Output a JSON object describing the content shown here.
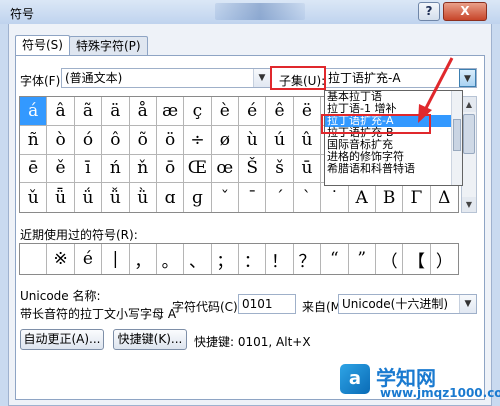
{
  "window": {
    "title": "符号",
    "help_glyph": "?",
    "close_glyph": "X"
  },
  "tabs": [
    {
      "label": "符号(S)",
      "active": true
    },
    {
      "label": "特殊字符(P)",
      "active": false
    }
  ],
  "font": {
    "label": "字体(F):",
    "value": "(普通文本)"
  },
  "subset": {
    "label": "子集(U):",
    "value": "拉丁语扩充-A"
  },
  "dropdown": {
    "items": [
      {
        "label": "基本拉丁语",
        "selected": false
      },
      {
        "label": "拉丁语-1 增补",
        "selected": false
      },
      {
        "label": "拉丁语扩充-A",
        "selected": true
      },
      {
        "label": "拉丁语扩充-B",
        "selected": false
      },
      {
        "label": "国际音标扩充",
        "selected": false
      },
      {
        "label": "进格的修饰字符",
        "selected": false
      },
      {
        "label": "希腊语和科普特语",
        "selected": false
      }
    ]
  },
  "symbols": [
    "á",
    "â",
    "ã",
    "ä",
    "å",
    "æ",
    "ç",
    "è",
    "é",
    "ê",
    "ë",
    "ì",
    "í",
    "î",
    "ï",
    "ð",
    "ñ",
    "ò",
    "ó",
    "ô",
    "õ",
    "ö",
    "÷",
    "ø",
    "ù",
    "ú",
    "û",
    "ü",
    "ý",
    "þ",
    "ÿ",
    "Ā",
    "ē",
    "ě",
    "ī",
    "ń",
    "ň",
    "ō",
    "Œ",
    "œ",
    "Š",
    "š",
    "ū",
    "Ž",
    "ž",
    "ǎ",
    "ǐ",
    "ǒ",
    "ǔ",
    "ǖ",
    "ǘ",
    "ǚ",
    "ǜ",
    "ɑ",
    "ɡ",
    "ˇ",
    "ˉ",
    "ˊ",
    "ˋ",
    "˙",
    "Α",
    "Β",
    "Γ",
    "Δ"
  ],
  "selected_symbol_index": 0,
  "recent": {
    "label": "近期使用过的符号(R):",
    "symbols": [
      "",
      "※",
      "é",
      "|",
      "，",
      "。",
      "、",
      "；",
      "：",
      "！",
      "？",
      "“",
      "”",
      "（",
      "【",
      "）"
    ]
  },
  "unicode": {
    "name_label": "Unicode 名称:",
    "name_value": "带长音符的拉丁文小写字母 A",
    "code_label": "字符代码(C):",
    "code_value": "0101",
    "from_label": "来自(M):",
    "from_value": "Unicode(十六进制)"
  },
  "buttons": {
    "autocorrect": "自动更正(A)...",
    "shortcut": "快捷键(K)...",
    "shortcut_info": "快捷键: 0101, Alt+X"
  },
  "watermark": {
    "logo_glyph": "a",
    "title": "学知网",
    "url": "www.jmqz1000.com"
  },
  "colors": {
    "highlight": "#e0282c",
    "selection": "#3399ff"
  }
}
